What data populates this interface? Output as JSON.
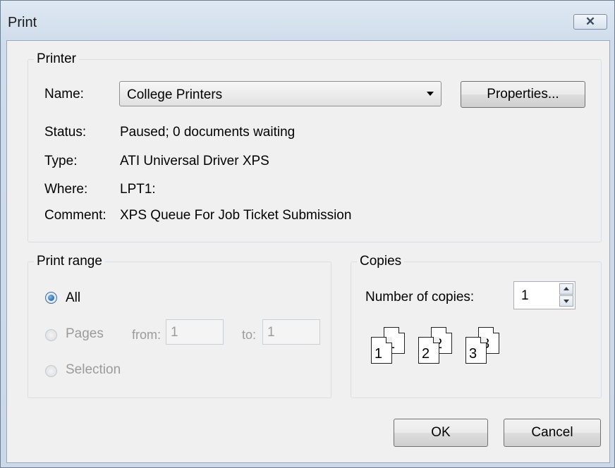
{
  "window": {
    "title": "Print",
    "close_label": "☒"
  },
  "printer": {
    "legend": "Printer",
    "name_label": "Name:",
    "name_value": "College Printers",
    "properties_button": "Properties...",
    "status_label": "Status:",
    "status_value": "Paused; 0 documents waiting",
    "type_label": "Type:",
    "type_value": "ATI Universal Driver XPS",
    "where_label": "Where:",
    "where_value": "LPT1:",
    "comment_label": "Comment:",
    "comment_value": "XPS Queue For Job Ticket Submission"
  },
  "print_range": {
    "legend": "Print range",
    "all_label": "All",
    "pages_label": "Pages",
    "from_label": "from:",
    "from_value": "1",
    "to_label": "to:",
    "to_value": "1",
    "selection_label": "Selection",
    "selected": "All"
  },
  "copies": {
    "legend": "Copies",
    "number_label": "Number of copies:",
    "number_value": "1",
    "collate_pages": [
      "1",
      "1",
      "2",
      "2",
      "3",
      "3"
    ]
  },
  "buttons": {
    "ok": "OK",
    "cancel": "Cancel"
  }
}
